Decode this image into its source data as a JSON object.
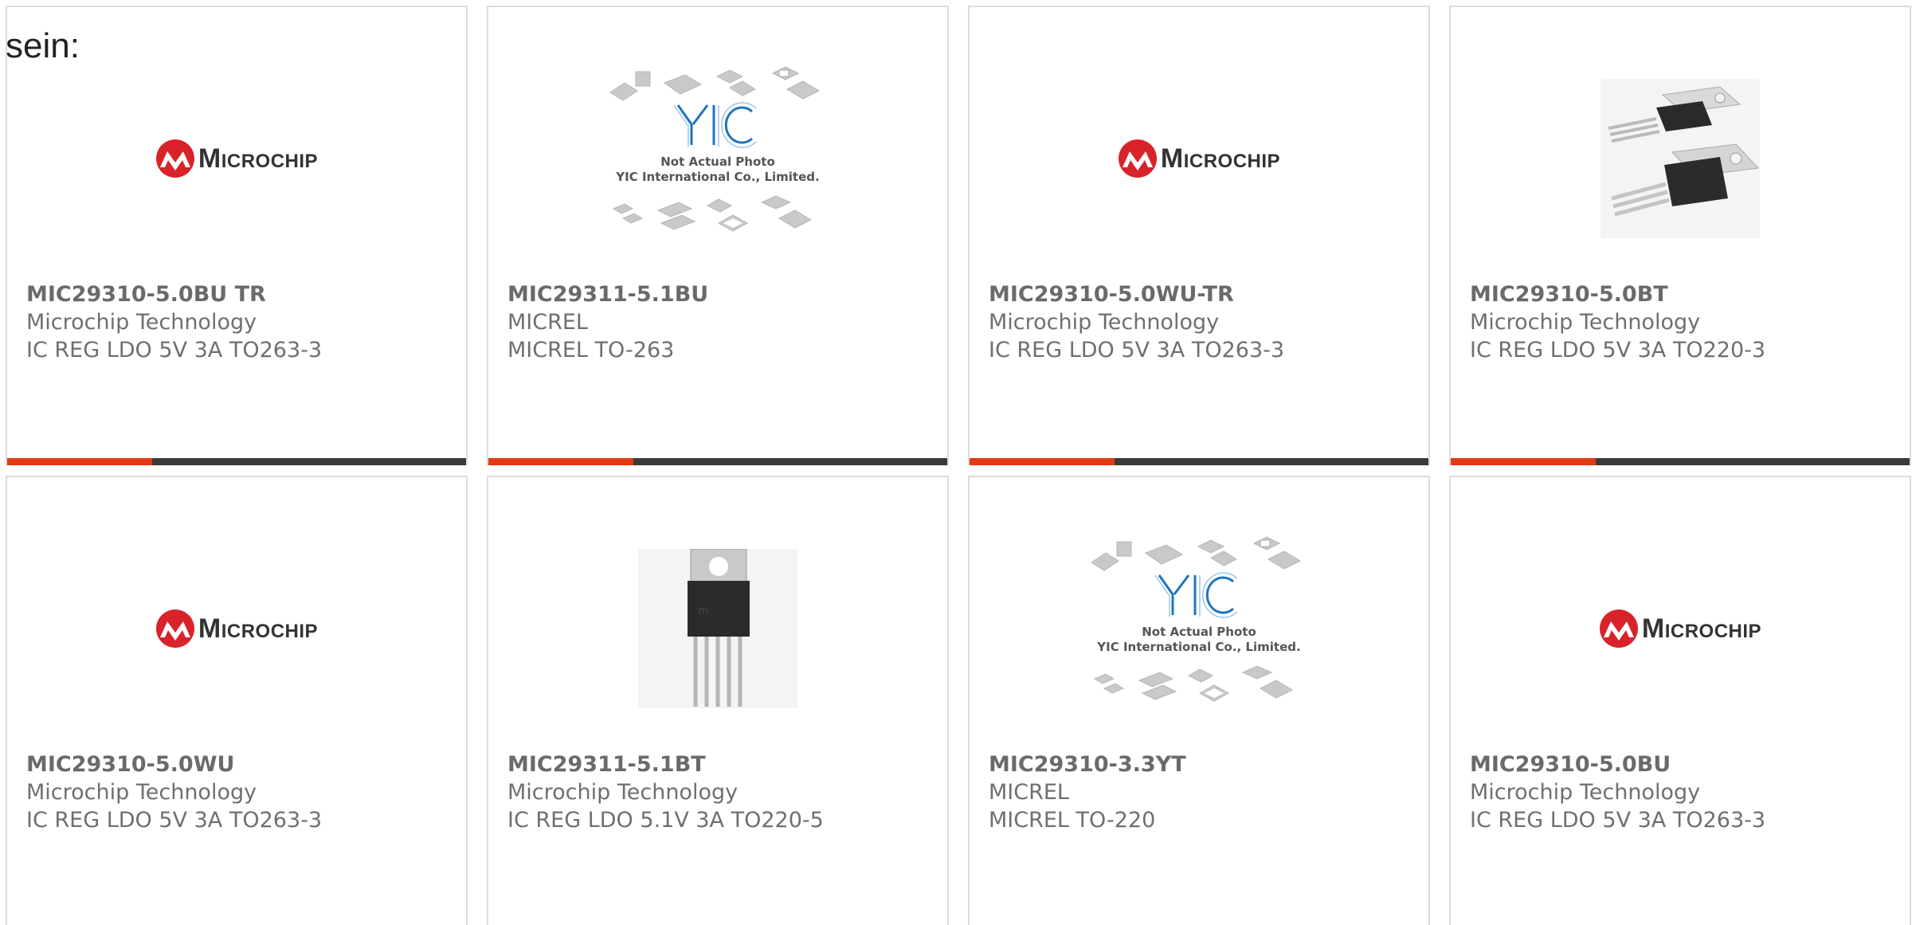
{
  "intro_text": "sein:",
  "colors": {
    "accent": "#e23a12",
    "bar": "#3a3a3a",
    "logo_red": "#d8232a"
  },
  "logo_text": "Microchip",
  "placeholder": {
    "line1": "Not Actual Photo",
    "line2": "YIC International Co., Limited.",
    "brand": "YIC"
  },
  "products": [
    {
      "part": "MIC29310-5.0BU TR",
      "maker": "Microchip Technology",
      "desc": "IC REG LDO 5V 3A TO263-3",
      "image": "microchip-logo"
    },
    {
      "part": "MIC29311-5.1BU",
      "maker": "MICREL",
      "desc": "MICREL TO-263",
      "image": "yic-placeholder"
    },
    {
      "part": "MIC29310-5.0WU-TR",
      "maker": "Microchip Technology",
      "desc": "IC REG LDO 5V 3A TO263-3",
      "image": "microchip-logo"
    },
    {
      "part": "MIC29310-5.0BT",
      "maker": "Microchip Technology",
      "desc": "IC REG LDO 5V 3A TO220-3",
      "image": "to220-3-photo"
    },
    {
      "part": "MIC29310-5.0WU",
      "maker": "Microchip Technology",
      "desc": "IC REG LDO 5V 3A TO263-3",
      "image": "microchip-logo"
    },
    {
      "part": "MIC29311-5.1BT",
      "maker": "Microchip Technology",
      "desc": "IC REG LDO 5.1V 3A TO220-5",
      "image": "to220-5-photo"
    },
    {
      "part": "MIC29310-3.3YT",
      "maker": "MICREL",
      "desc": "MICREL TO-220",
      "image": "yic-placeholder"
    },
    {
      "part": "MIC29310-5.0BU",
      "maker": "Microchip Technology",
      "desc": "IC REG LDO 5V 3A TO263-3",
      "image": "microchip-logo"
    }
  ]
}
